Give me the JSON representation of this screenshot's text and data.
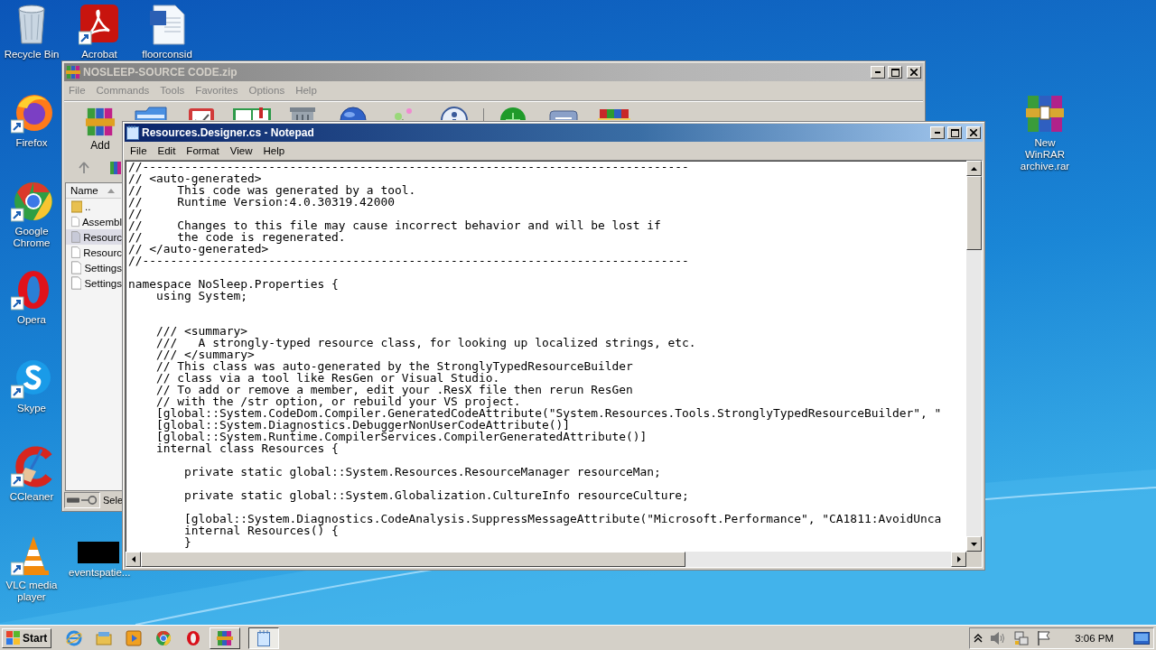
{
  "desktop_icons": [
    {
      "kind": "recycle",
      "label": "Recycle Bin"
    },
    {
      "kind": "acrobat",
      "label": "Acrobat"
    },
    {
      "kind": "word",
      "label": "floorconsid"
    },
    {
      "kind": "firefox",
      "label": "Firefox"
    },
    {
      "kind": "chrome",
      "label": "Google Chrome"
    },
    {
      "kind": "opera",
      "label": "Opera"
    },
    {
      "kind": "skype",
      "label": "Skype"
    },
    {
      "kind": "ccleaner",
      "label": "CCleaner"
    },
    {
      "kind": "vlc",
      "label": "VLC media player"
    },
    {
      "kind": "thumbnail",
      "label": "eventspatie..."
    },
    {
      "kind": "winrar",
      "label": "New WinRAR archive.rar"
    }
  ],
  "archive_window": {
    "title": "NOSLEEP-SOURCE CODE.zip",
    "menu": [
      "File",
      "Commands",
      "Tools",
      "Favorites",
      "Options",
      "Help"
    ],
    "toolbar": [
      {
        "kind": "add",
        "label": "Add"
      },
      {
        "kind": "folder"
      },
      {
        "kind": "clipboard"
      },
      {
        "kind": "book"
      },
      {
        "kind": "trash"
      },
      {
        "kind": "globe"
      },
      {
        "kind": "wand"
      },
      {
        "kind": "info"
      },
      {
        "kind": "shield"
      },
      {
        "kind": "drive"
      },
      {
        "kind": "books"
      }
    ],
    "list_header": "Name",
    "files": [
      {
        "kind": "folder",
        "name": "..",
        "selected": false
      },
      {
        "kind": "file",
        "name": "Assembl",
        "selected": false
      },
      {
        "kind": "file",
        "name": "Resourc",
        "selected": true
      },
      {
        "kind": "file",
        "name": "Resourc",
        "selected": false
      },
      {
        "kind": "file",
        "name": "Settings",
        "selected": false
      },
      {
        "kind": "file",
        "name": "Settings",
        "selected": false
      }
    ],
    "status_text": "Sele"
  },
  "notepad": {
    "title": "Resources.Designer.cs - Notepad",
    "menu": [
      "File",
      "Edit",
      "Format",
      "View",
      "Help"
    ],
    "lines": [
      {
        "text": "//------------------------------------------------------------------------------"
      },
      {
        "text": "// <auto-generated>"
      },
      {
        "text": "//     This code was generated by a tool."
      },
      {
        "text": "//     Runtime Version:4.0.30319.42000"
      },
      {
        "text": "//"
      },
      {
        "text": "//     Changes to this file may cause incorrect behavior and will be lost if"
      },
      {
        "text": "//     the code is regenerated."
      },
      {
        "text": "// </auto-generated>"
      },
      {
        "text": "//------------------------------------------------------------------------------"
      },
      {
        "text": "namespace NoSleep.Properties {",
        "blank_before": true
      },
      {
        "text": "    using System;",
        "blank_after": true
      },
      {
        "text": "    /// <summary>",
        "blank_before": true
      },
      {
        "text": "    ///   A strongly-typed resource class, for looking up localized strings, etc."
      },
      {
        "text": "    /// </summary>"
      },
      {
        "text": "    // This class was auto-generated by the StronglyTypedResourceBuilder"
      },
      {
        "text": "    // class via a tool like ResGen or Visual Studio."
      },
      {
        "text": "    // To add or remove a member, edit your .ResX file then rerun ResGen"
      },
      {
        "text": "    // with the /str option, or rebuild your VS project."
      },
      {
        "text": "    [global::System.CodeDom.Compiler.GeneratedCodeAttribute(\"System.Resources.Tools.StronglyTypedResourceBuilder\", \""
      },
      {
        "text": "    [global::System.Diagnostics.DebuggerNonUserCodeAttribute()]"
      },
      {
        "text": "    [global::System.Runtime.CompilerServices.CompilerGeneratedAttribute()]"
      },
      {
        "text": "    internal class Resources {"
      },
      {
        "text": "        private static global::System.Resources.ResourceManager resourceMan;",
        "blank_before": true
      },
      {
        "text": "        private static global::System.Globalization.CultureInfo resourceCulture;",
        "blank_before": true
      },
      {
        "text": "        [global::System.Diagnostics.CodeAnalysis.SuppressMessageAttribute(\"Microsoft.Performance\", \"CA1811:AvoidUnca",
        "blank_before": true
      },
      {
        "text": "        internal Resources() {"
      },
      {
        "text": "        }"
      }
    ]
  },
  "taskbar": {
    "start": "Start",
    "quick_launch": [
      {
        "kind": "ie"
      },
      {
        "kind": "explorer"
      },
      {
        "kind": "media"
      },
      {
        "kind": "chrome"
      },
      {
        "kind": "opera"
      }
    ],
    "windows": [
      {
        "kind": "winrar",
        "selected": false
      },
      {
        "kind": "notepad",
        "selected": true
      }
    ],
    "clock": "3:06 PM"
  }
}
